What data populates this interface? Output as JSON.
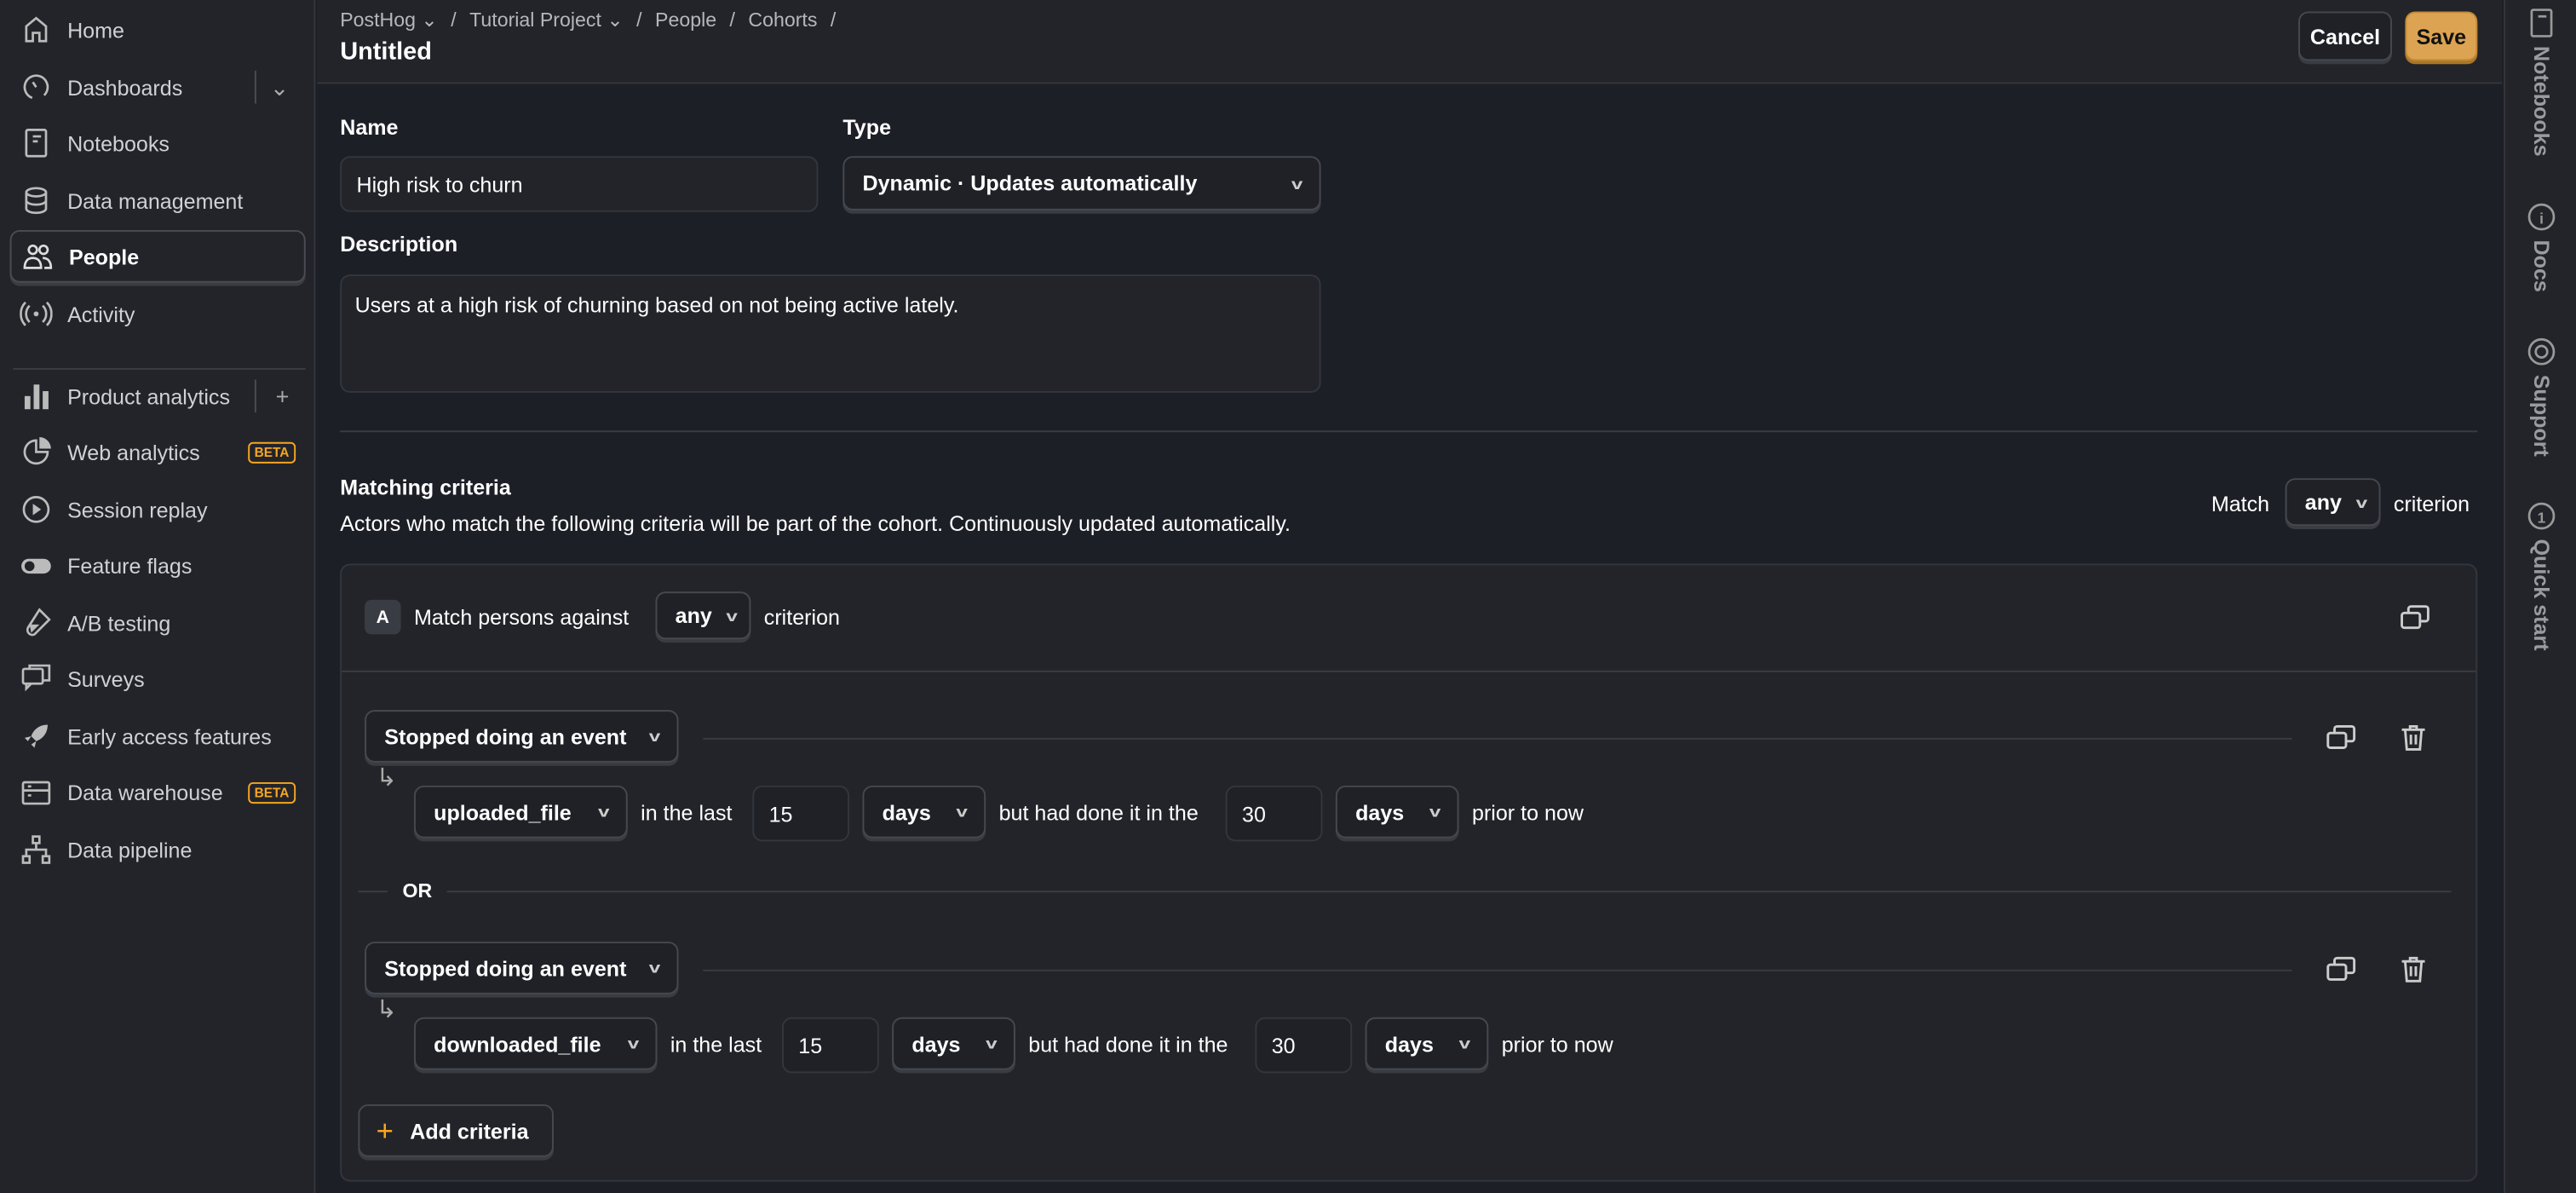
{
  "sidebar": {
    "items": [
      {
        "label": "Home",
        "icon": "home-icon"
      },
      {
        "label": "Dashboards",
        "icon": "dashboard-icon"
      },
      {
        "label": "Notebooks",
        "icon": "notebook-icon"
      },
      {
        "label": "Data management",
        "icon": "database-icon"
      },
      {
        "label": "People",
        "icon": "people-icon",
        "active": true
      },
      {
        "label": "Activity",
        "icon": "broadcast-icon"
      },
      {
        "label": "Product analytics",
        "icon": "bar-chart-icon"
      },
      {
        "label": "Web analytics",
        "icon": "pie-chart-icon",
        "badge": "BETA"
      },
      {
        "label": "Session replay",
        "icon": "play-icon"
      },
      {
        "label": "Feature flags",
        "icon": "toggle-icon"
      },
      {
        "label": "A/B testing",
        "icon": "flask-icon"
      },
      {
        "label": "Surveys",
        "icon": "chat-icon"
      },
      {
        "label": "Early access features",
        "icon": "rocket-icon"
      },
      {
        "label": "Data warehouse",
        "icon": "server-icon",
        "badge": "BETA"
      },
      {
        "label": "Data pipeline",
        "icon": "pipeline-icon"
      }
    ]
  },
  "header": {
    "breadcrumbs": [
      "PostHog",
      "Tutorial Project",
      "People",
      "Cohorts"
    ],
    "title": "Untitled",
    "cancel": "Cancel",
    "save": "Save"
  },
  "right_panel": [
    "Notebooks",
    "Docs",
    "Support",
    "Quick start"
  ],
  "form": {
    "name_label": "Name",
    "name_value": "High risk to churn",
    "type_label": "Type",
    "type_value": "Dynamic · Updates automatically",
    "description_label": "Description",
    "description_value": "Users at a high risk of churning based on not being active lately."
  },
  "criteria": {
    "title": "Matching criteria",
    "subtitle": "Actors who match the following criteria will be part of the cohort. Continuously updated automatically.",
    "match_label": "Match",
    "match_value": "any",
    "criterion": "criterion",
    "group": {
      "letter": "A",
      "prefix": "Match persons against",
      "value": "any",
      "suffix": "criterion"
    },
    "or": "OR",
    "rows": [
      {
        "behavior": "Stopped doing an event",
        "event": "uploaded_file",
        "in_last": "in the last",
        "n1": "15",
        "unit1": "days",
        "but": "but had done it in the",
        "n2": "30",
        "unit2": "days",
        "prior": "prior to now"
      },
      {
        "behavior": "Stopped doing an event",
        "event": "downloaded_file",
        "in_last": "in the last",
        "n1": "15",
        "unit1": "days",
        "but": "but had done it in the",
        "n2": "30",
        "unit2": "days",
        "prior": "prior to now"
      }
    ],
    "add": "Add criteria"
  },
  "colors": {
    "accent": "#dca352",
    "bg": "#1d1f27",
    "panel": "#232429"
  }
}
